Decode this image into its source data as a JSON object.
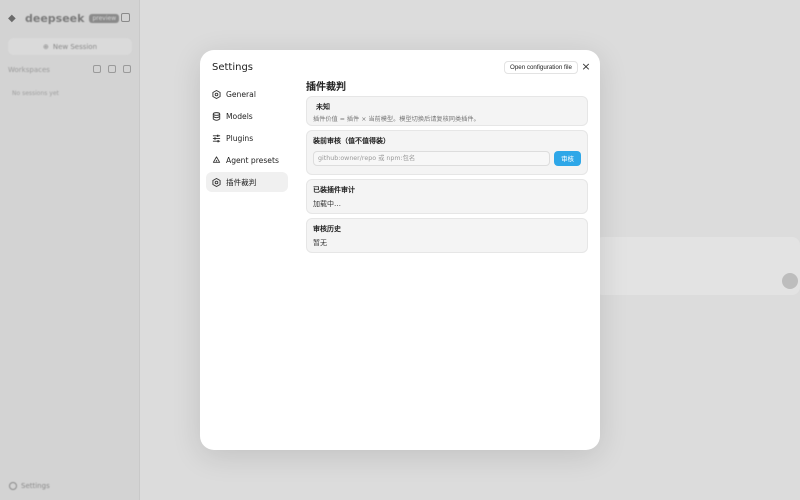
{
  "app": {
    "brand": "deepseek",
    "brand_badge": "preview",
    "new_session_label": "New Session",
    "workspace_label": "Workspaces",
    "empty_sessions": "No sessions yet",
    "settings_label": "Settings"
  },
  "settings": {
    "title": "Settings",
    "open_config_label": "Open configuration file",
    "close_icon": "×",
    "nav": [
      {
        "label": "General",
        "icon": "hexagon-gear-icon"
      },
      {
        "label": "Models",
        "icon": "database-icon"
      },
      {
        "label": "Plugins",
        "icon": "sliders-icon"
      },
      {
        "label": "Agent presets",
        "icon": "recycle-icon"
      },
      {
        "label": "插件裁判",
        "icon": "hexagon-gear-icon",
        "active": true
      }
    ]
  },
  "plugin_judge": {
    "title": "插件裁判",
    "unknown": {
      "title": "未知",
      "subtitle": "插件价值 = 插件 × 当前模型。模型切换后请复核同类插件。"
    },
    "pre_install": {
      "title": "装前审核（值不值得装）",
      "input_placeholder": "github:owner/repo 或 npm:包名",
      "input_value": "",
      "button_label": "审核"
    },
    "installed_audit": {
      "title": "已装插件审计",
      "status": "加载中…"
    },
    "history": {
      "title": "审核历史",
      "status": "暂无"
    }
  },
  "colors": {
    "accent": "#2ea7e8",
    "overlay": "#dcdcdc",
    "modal_bg": "#ffffff",
    "card_bg": "#f4f4f4"
  }
}
